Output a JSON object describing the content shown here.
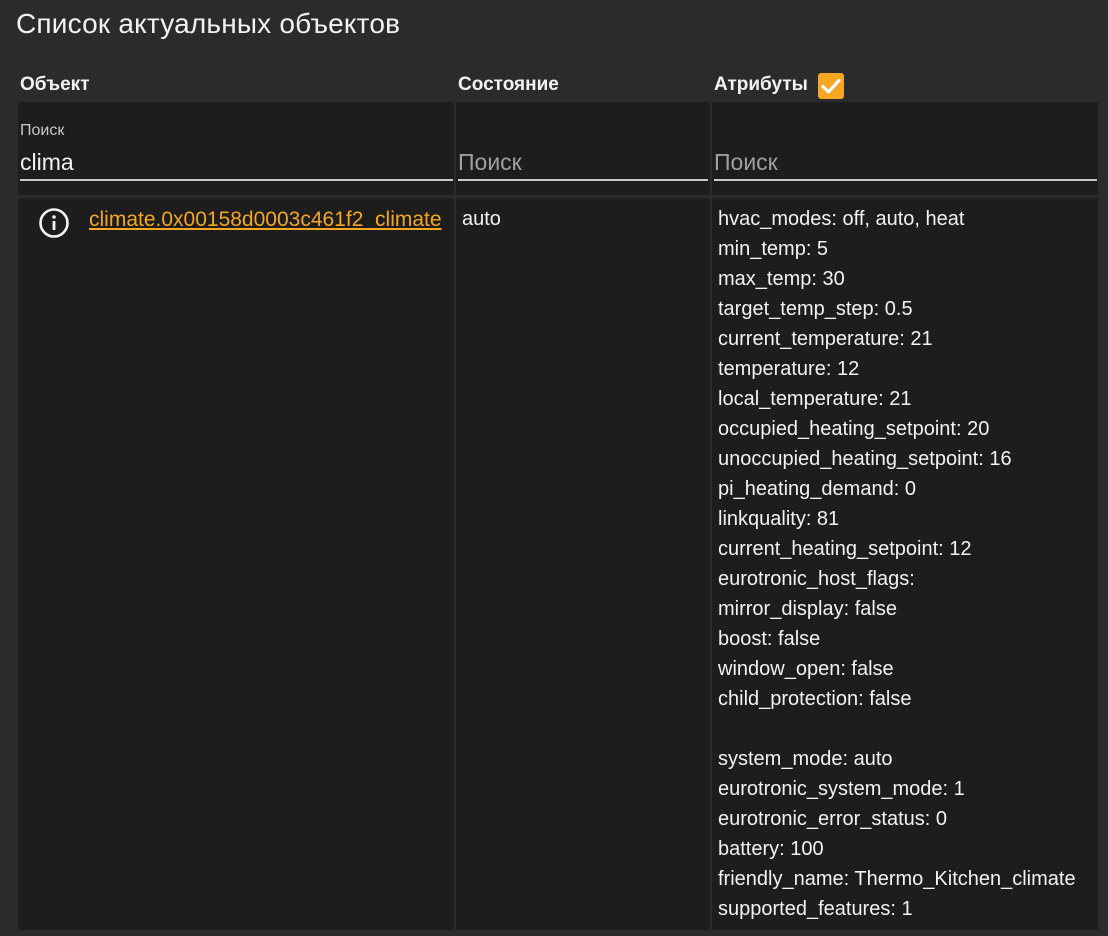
{
  "page": {
    "title": "Список актуальных объектов"
  },
  "table": {
    "headers": {
      "entity": "Объект",
      "state": "Состояние",
      "attributes": "Атрибуты"
    },
    "attributes_checkbox_checked": true,
    "filters": {
      "entity_label": "Поиск",
      "entity_value": "clima",
      "state_placeholder": "Поиск",
      "attributes_placeholder": "Поиск"
    },
    "rows": [
      {
        "entity_id": "climate.0x00158d0003c461f2_climate",
        "state": "auto",
        "attributes": [
          "hvac_modes: off, auto, heat",
          "min_temp: 5",
          "max_temp: 30",
          "target_temp_step: 0.5",
          "current_temperature: 21",
          "temperature: 12",
          "local_temperature: 21",
          "occupied_heating_setpoint: 20",
          "unoccupied_heating_setpoint: 16",
          "pi_heating_demand: 0",
          "linkquality: 81",
          "current_heating_setpoint: 12",
          "eurotronic_host_flags:",
          "mirror_display: false",
          "boost: false",
          "window_open: false",
          "child_protection: false",
          "",
          "system_mode: auto",
          "eurotronic_system_mode: 1",
          "eurotronic_error_status: 0",
          "battery: 100",
          "friendly_name: Thermo_Kitchen_climate",
          "supported_features: 1"
        ]
      }
    ]
  },
  "colors": {
    "background": "#2b2b2d",
    "cell": "#1d1d1d",
    "accent": "#f5a623",
    "text": "#f2f2f2"
  },
  "icons": {
    "row_info": "info-circle-icon",
    "checkbox": "checkmark-icon"
  }
}
